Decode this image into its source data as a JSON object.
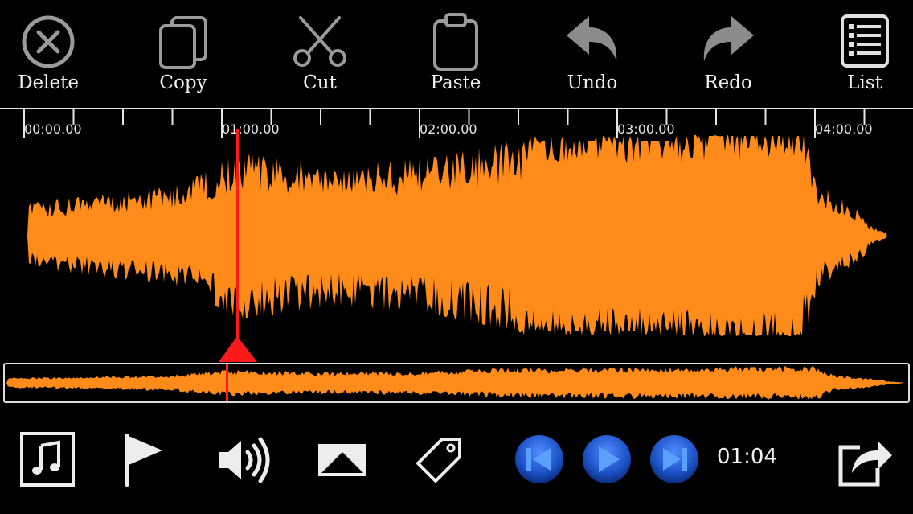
{
  "toolbar": {
    "delete_label": "Delete",
    "copy_label": "Copy",
    "cut_label": "Cut",
    "paste_label": "Paste",
    "undo_label": "Undo",
    "redo_label": "Redo",
    "list_label": "List"
  },
  "timeline": {
    "labels": [
      "00:00.00",
      "01:00.00",
      "02:00.00",
      "03:00.00",
      "04:00.00"
    ]
  },
  "playback": {
    "current_time": "01:04"
  },
  "colors": {
    "waveform": "#ff8c1a",
    "playhead": "#ff1a1a",
    "transport_button": "#1a5fd6"
  },
  "icons": {
    "delete": "close-circle-icon",
    "copy": "copy-icon",
    "cut": "scissors-icon",
    "paste": "clipboard-icon",
    "undo": "undo-arrow-icon",
    "redo": "redo-arrow-icon",
    "list": "list-icon",
    "music": "music-note-icon",
    "marker": "flag-icon",
    "volume": "speaker-icon",
    "fade": "fade-icon",
    "tag": "tag-icon",
    "prev": "skip-previous-icon",
    "play": "play-icon",
    "next": "skip-next-icon",
    "share": "share-icon"
  }
}
